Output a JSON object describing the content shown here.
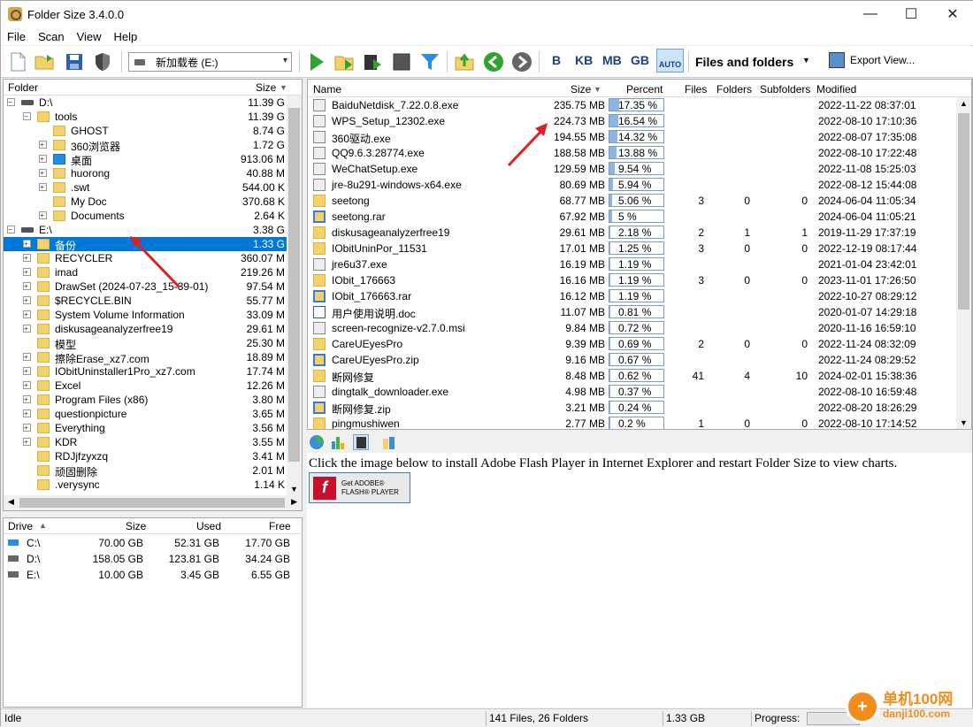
{
  "window": {
    "title": "Folder Size 3.4.0.0",
    "minimize": "—",
    "maximize": "☐",
    "close": "✕"
  },
  "menu": [
    "File",
    "Scan",
    "View",
    "Help"
  ],
  "toolbar": {
    "drive_value": "新加载卷 (E:)",
    "units": [
      "B",
      "KB",
      "MB",
      "GB"
    ],
    "auto_label": "AUTO",
    "view_mode": "Files and folders",
    "export_label": "Export View..."
  },
  "left": {
    "header": {
      "folder": "Folder",
      "size": "Size"
    },
    "tree": [
      {
        "name": "D:\\",
        "size": "11.39 G",
        "kind": "drive",
        "indent": 0,
        "expander": "−"
      },
      {
        "name": "tools",
        "size": "11.39 G",
        "kind": "folder",
        "indent": 1,
        "expander": "−"
      },
      {
        "name": "GHOST",
        "size": "8.74 G",
        "kind": "folder",
        "indent": 2,
        "expander": ""
      },
      {
        "name": "360浏览器",
        "size": "1.72 G",
        "kind": "folder",
        "indent": 2,
        "expander": "+"
      },
      {
        "name": "桌面",
        "size": "913.06 M",
        "kind": "blue",
        "indent": 2,
        "expander": "+"
      },
      {
        "name": "huorong",
        "size": "40.88 M",
        "kind": "folder",
        "indent": 2,
        "expander": "+"
      },
      {
        "name": ".swt",
        "size": "544.00 K",
        "kind": "folder",
        "indent": 2,
        "expander": "+"
      },
      {
        "name": "My Doc",
        "size": "370.68 K",
        "kind": "folder",
        "indent": 2,
        "expander": ""
      },
      {
        "name": "Documents",
        "size": "2.64 K",
        "kind": "folder",
        "indent": 2,
        "expander": "+"
      },
      {
        "name": "E:\\",
        "size": "3.38 G",
        "kind": "drive",
        "indent": 0,
        "expander": "−"
      },
      {
        "name": "备份",
        "size": "1.33 G",
        "kind": "folder",
        "indent": 1,
        "expander": "+",
        "selected": true
      },
      {
        "name": "RECYCLER",
        "size": "360.07 M",
        "kind": "folder",
        "indent": 1,
        "expander": "+"
      },
      {
        "name": "imad",
        "size": "219.26 M",
        "kind": "folder",
        "indent": 1,
        "expander": "+"
      },
      {
        "name": "DrawSet (2024-07-23_15-39-01)",
        "size": "97.54 M",
        "kind": "folder",
        "indent": 1,
        "expander": "+"
      },
      {
        "name": "$RECYCLE.BIN",
        "size": "55.77 M",
        "kind": "folder",
        "indent": 1,
        "expander": "+"
      },
      {
        "name": "System Volume Information",
        "size": "33.09 M",
        "kind": "folder",
        "indent": 1,
        "expander": "+"
      },
      {
        "name": "diskusageanalyzerfree19",
        "size": "29.61 M",
        "kind": "folder",
        "indent": 1,
        "expander": "+"
      },
      {
        "name": "模型",
        "size": "25.30 M",
        "kind": "folder",
        "indent": 1,
        "expander": ""
      },
      {
        "name": "擦除Erase_xz7.com",
        "size": "18.89 M",
        "kind": "folder",
        "indent": 1,
        "expander": "+"
      },
      {
        "name": "IObitUninstaller1Pro_xz7.com",
        "size": "17.74 M",
        "kind": "folder",
        "indent": 1,
        "expander": "+"
      },
      {
        "name": "Excel",
        "size": "12.26 M",
        "kind": "folder",
        "indent": 1,
        "expander": "+"
      },
      {
        "name": "Program Files (x86)",
        "size": "3.80 M",
        "kind": "folder",
        "indent": 1,
        "expander": "+"
      },
      {
        "name": "questionpicture",
        "size": "3.65 M",
        "kind": "folder",
        "indent": 1,
        "expander": "+"
      },
      {
        "name": "Everything",
        "size": "3.56 M",
        "kind": "folder",
        "indent": 1,
        "expander": "+"
      },
      {
        "name": "KDR",
        "size": "3.55 M",
        "kind": "folder",
        "indent": 1,
        "expander": "+"
      },
      {
        "name": "RDJjfzyxzq",
        "size": "3.41 M",
        "kind": "folder",
        "indent": 1,
        "expander": ""
      },
      {
        "name": "顽固删除",
        "size": "2.01 M",
        "kind": "folder",
        "indent": 1,
        "expander": ""
      },
      {
        "name": ".verysync",
        "size": "1.14 K",
        "kind": "folder",
        "indent": 1,
        "expander": ""
      }
    ]
  },
  "drives": {
    "header": {
      "drive": "Drive",
      "size": "Size",
      "used": "Used",
      "free": "Free"
    },
    "rows": [
      {
        "drive": "C:\\",
        "size": "70.00 GB",
        "used": "52.31 GB",
        "free": "17.70 GB"
      },
      {
        "drive": "D:\\",
        "size": "158.05 GB",
        "used": "123.81 GB",
        "free": "34.24 GB"
      },
      {
        "drive": "E:\\",
        "size": "10.00 GB",
        "used": "3.45 GB",
        "free": "6.55 GB"
      }
    ]
  },
  "files": {
    "header": {
      "name": "Name",
      "size": "Size",
      "percent": "Percent",
      "files": "Files",
      "folders": "Folders",
      "subfolders": "Subfolders",
      "modified": "Modified"
    },
    "rows": [
      {
        "name": "BaiduNetdisk_7.22.0.8.exe",
        "size": "235.75 MB",
        "percent": "17.35 %",
        "pct": 17.35,
        "files": "",
        "folders": "",
        "subfolders": "",
        "modified": "2022-11-22 08:37:01",
        "icon": "exe"
      },
      {
        "name": "WPS_Setup_12302.exe",
        "size": "224.73 MB",
        "percent": "16.54 %",
        "pct": 16.54,
        "files": "",
        "folders": "",
        "subfolders": "",
        "modified": "2022-08-10 17:10:36",
        "icon": "exe"
      },
      {
        "name": "360驱动.exe",
        "size": "194.55 MB",
        "percent": "14.32 %",
        "pct": 14.32,
        "files": "",
        "folders": "",
        "subfolders": "",
        "modified": "2022-08-07 17:35:08",
        "icon": "exe"
      },
      {
        "name": "QQ9.6.3.28774.exe",
        "size": "188.58 MB",
        "percent": "13.88 %",
        "pct": 13.88,
        "files": "",
        "folders": "",
        "subfolders": "",
        "modified": "2022-08-10 17:22:48",
        "icon": "exe"
      },
      {
        "name": "WeChatSetup.exe",
        "size": "129.59 MB",
        "percent": "9.54 %",
        "pct": 9.54,
        "files": "",
        "folders": "",
        "subfolders": "",
        "modified": "2022-11-08 15:25:03",
        "icon": "exe"
      },
      {
        "name": "jre-8u291-windows-x64.exe",
        "size": "80.69 MB",
        "percent": "5.94 %",
        "pct": 5.94,
        "files": "",
        "folders": "",
        "subfolders": "",
        "modified": "2022-08-12 15:44:08",
        "icon": "exe"
      },
      {
        "name": "seetong",
        "size": "68.77 MB",
        "percent": "5.06 %",
        "pct": 5.06,
        "files": "3",
        "folders": "0",
        "subfolders": "0",
        "modified": "2024-06-04 11:05:34",
        "icon": "folder"
      },
      {
        "name": "seetong.rar",
        "size": "67.92 MB",
        "percent": "5 %",
        "pct": 5.0,
        "files": "",
        "folders": "",
        "subfolders": "",
        "modified": "2024-06-04 11:05:21",
        "icon": "arc"
      },
      {
        "name": "diskusageanalyzerfree19",
        "size": "29.61 MB",
        "percent": "2.18 %",
        "pct": 2.18,
        "files": "2",
        "folders": "1",
        "subfolders": "1",
        "modified": "2019-11-29 17:37:19",
        "icon": "folder"
      },
      {
        "name": "IObitUninPor_11531",
        "size": "17.01 MB",
        "percent": "1.25 %",
        "pct": 1.25,
        "files": "3",
        "folders": "0",
        "subfolders": "0",
        "modified": "2022-12-19 08:17:44",
        "icon": "folder"
      },
      {
        "name": "jre6u37.exe",
        "size": "16.19 MB",
        "percent": "1.19 %",
        "pct": 1.19,
        "files": "",
        "folders": "",
        "subfolders": "",
        "modified": "2021-01-04 23:42:01",
        "icon": "exe"
      },
      {
        "name": "IObit_176663",
        "size": "16.16 MB",
        "percent": "1.19 %",
        "pct": 1.19,
        "files": "3",
        "folders": "0",
        "subfolders": "0",
        "modified": "2023-11-01 17:26:50",
        "icon": "folder"
      },
      {
        "name": "IObit_176663.rar",
        "size": "16.12 MB",
        "percent": "1.19 %",
        "pct": 1.19,
        "files": "",
        "folders": "",
        "subfolders": "",
        "modified": "2022-10-27 08:29:12",
        "icon": "arc"
      },
      {
        "name": "用户使用说明.doc",
        "size": "11.07 MB",
        "percent": "0.81 %",
        "pct": 0.81,
        "files": "",
        "folders": "",
        "subfolders": "",
        "modified": "2020-01-07 14:29:18",
        "icon": "doc"
      },
      {
        "name": "screen-recognize-v2.7.0.msi",
        "size": "9.84 MB",
        "percent": "0.72 %",
        "pct": 0.72,
        "files": "",
        "folders": "",
        "subfolders": "",
        "modified": "2020-11-16 16:59:10",
        "icon": "exe"
      },
      {
        "name": "CareUEyesPro",
        "size": "9.39 MB",
        "percent": "0.69 %",
        "pct": 0.69,
        "files": "2",
        "folders": "0",
        "subfolders": "0",
        "modified": "2022-11-24 08:32:09",
        "icon": "folder"
      },
      {
        "name": "CareUEyesPro.zip",
        "size": "9.16 MB",
        "percent": "0.67 %",
        "pct": 0.67,
        "files": "",
        "folders": "",
        "subfolders": "",
        "modified": "2022-11-24 08:29:52",
        "icon": "arc"
      },
      {
        "name": "断网修复",
        "size": "8.48 MB",
        "percent": "0.62 %",
        "pct": 0.62,
        "files": "41",
        "folders": "4",
        "subfolders": "10",
        "modified": "2024-02-01 15:38:36",
        "icon": "folder"
      },
      {
        "name": "dingtalk_downloader.exe",
        "size": "4.98 MB",
        "percent": "0.37 %",
        "pct": 0.37,
        "files": "",
        "folders": "",
        "subfolders": "",
        "modified": "2022-08-10 16:59:48",
        "icon": "exe"
      },
      {
        "name": "断网修复.zip",
        "size": "3.21 MB",
        "percent": "0.24 %",
        "pct": 0.24,
        "files": "",
        "folders": "",
        "subfolders": "",
        "modified": "2022-08-20 18:26:29",
        "icon": "arc"
      },
      {
        "name": "pingmushiwen",
        "size": "2.77 MB",
        "percent": "0.2 %",
        "pct": 0.2,
        "files": "1",
        "folders": "0",
        "subfolders": "0",
        "modified": "2022-08-10 17:14:52",
        "icon": "folder"
      }
    ]
  },
  "chart": {
    "message": "Click the image below to install Adobe Flash Player in Internet Explorer and restart Folder Size to view charts.",
    "button_line1": "Get ADOBE®",
    "button_line2": "FLASH® PLAYER"
  },
  "status": {
    "state": "Idle",
    "counts": "141 Files, 26 Folders",
    "total": "1.33 GB",
    "progress_label": "Progress:"
  },
  "watermark": {
    "site_cn": "单机100网",
    "site_url": "danji100.com"
  }
}
